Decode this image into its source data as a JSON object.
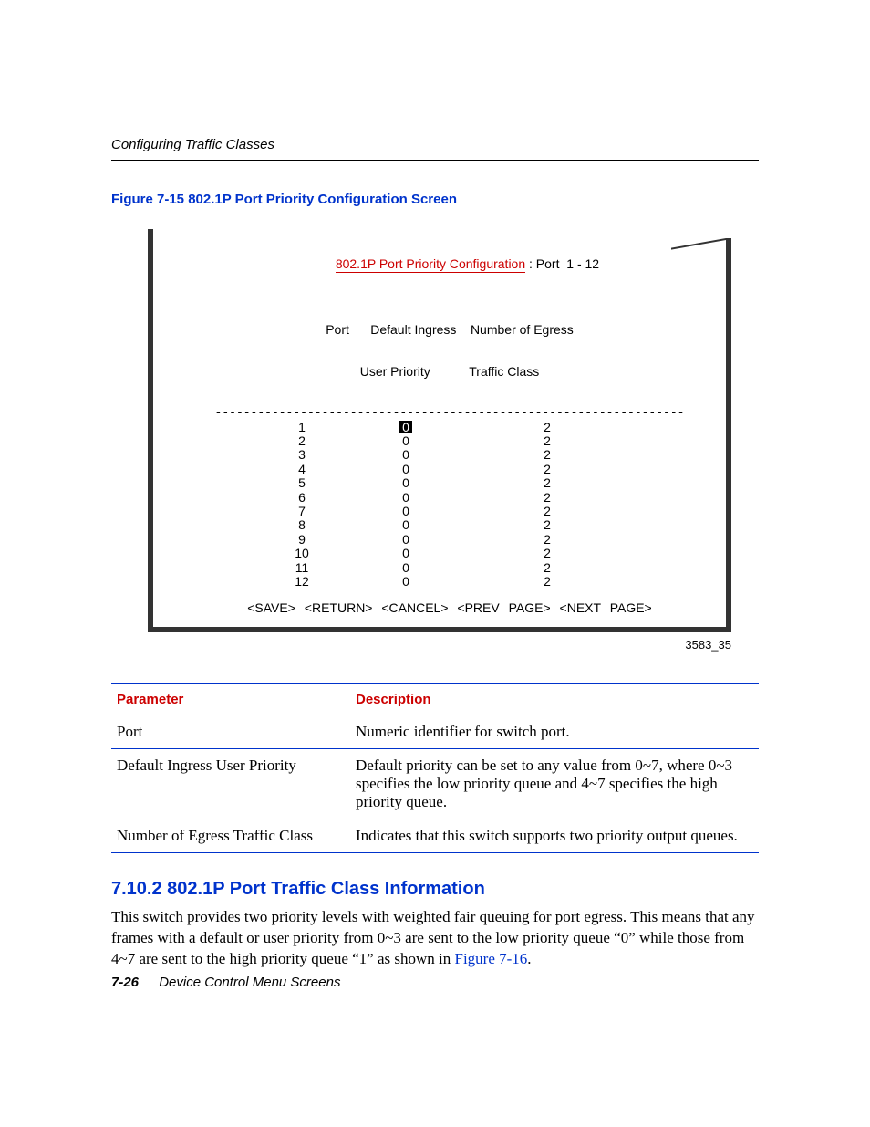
{
  "running_head": "Configuring Traffic Classes",
  "figure": {
    "caption": "Figure 7-15   802.1P Port Priority Configuration Screen",
    "title_link": "802.1P Port Priority Configuration",
    "title_rest": " : Port  1 - 12",
    "col_heads_line1": "Port      Default Ingress    Number of Egress",
    "col_heads_line2": "User Priority           Traffic Class",
    "separator": "------------------------------------------------------------------",
    "rows": [
      {
        "port": "1",
        "priority": "0",
        "egress": "2",
        "selected": true
      },
      {
        "port": "2",
        "priority": "0",
        "egress": "2",
        "selected": false
      },
      {
        "port": "3",
        "priority": "0",
        "egress": "2",
        "selected": false
      },
      {
        "port": "4",
        "priority": "0",
        "egress": "2",
        "selected": false
      },
      {
        "port": "5",
        "priority": "0",
        "egress": "2",
        "selected": false
      },
      {
        "port": "6",
        "priority": "0",
        "egress": "2",
        "selected": false
      },
      {
        "port": "7",
        "priority": "0",
        "egress": "2",
        "selected": false
      },
      {
        "port": "8",
        "priority": "0",
        "egress": "2",
        "selected": false
      },
      {
        "port": "9",
        "priority": "0",
        "egress": "2",
        "selected": false
      },
      {
        "port": "10",
        "priority": "0",
        "egress": "2",
        "selected": false
      },
      {
        "port": "11",
        "priority": "0",
        "egress": "2",
        "selected": false
      },
      {
        "port": "12",
        "priority": "0",
        "egress": "2",
        "selected": false
      }
    ],
    "actions": {
      "save": "<SAVE>",
      "return": "<RETURN>",
      "cancel": "<CANCEL>",
      "prev": "<PREV PAGE>",
      "next": "<NEXT PAGE>"
    },
    "id": "3583_35"
  },
  "ptable": {
    "headers": {
      "param": "Parameter",
      "desc": "Description"
    },
    "rows": [
      {
        "param": "Port",
        "desc": "Numeric identifier for switch port."
      },
      {
        "param": "Default Ingress User Priority",
        "desc": "Default priority can be set to any value from 0~7, where 0~3 specifies the low priority queue and 4~7 specifies the high priority queue."
      },
      {
        "param": "Number of Egress Traffic Class",
        "desc": "Indicates that this switch supports two priority output queues."
      }
    ]
  },
  "section": {
    "heading": "7.10.2  802.1P Port Traffic Class Information",
    "para_pre": "This switch provides two priority levels with weighted fair queuing for port egress. This means that any frames with a default or user priority from 0~3 are sent to the low priority queue “0” while those from 4~7 are sent to the high priority queue “1” as shown in ",
    "para_link": "Figure 7-16",
    "para_post": "."
  },
  "footer": {
    "page": "7-26",
    "title": "Device Control Menu Screens"
  }
}
